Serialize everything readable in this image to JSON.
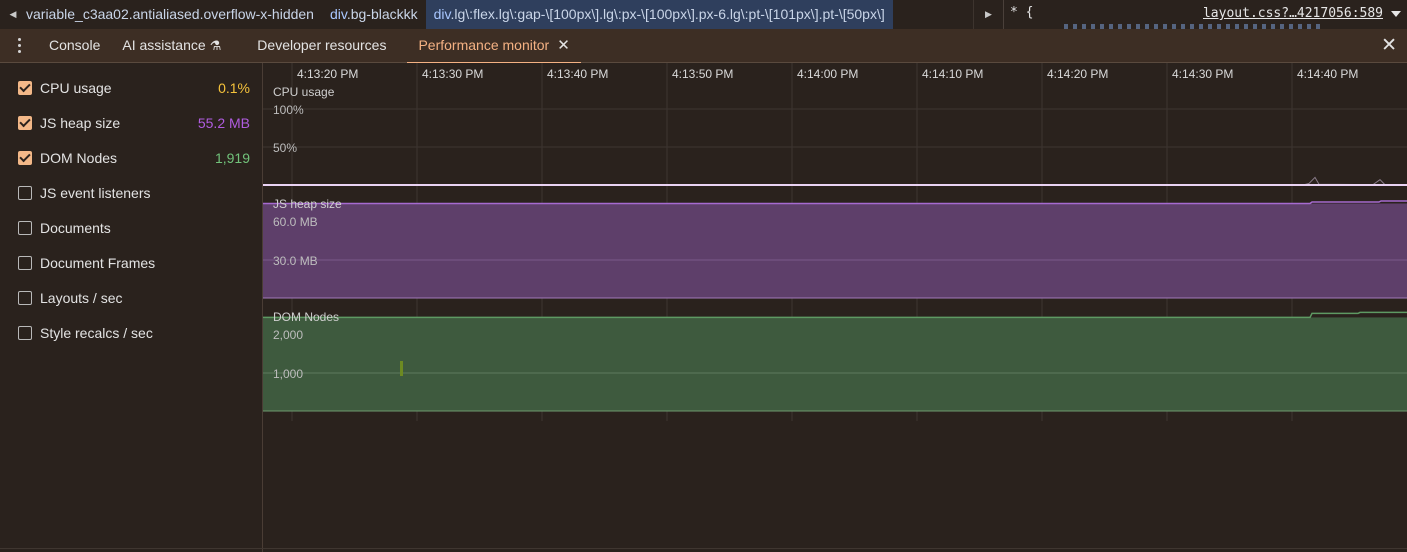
{
  "breadcrumbs": {
    "items": [
      {
        "tag": "",
        "cls": "variable_c3aa02.antialiased.overflow-x-hidden"
      },
      {
        "tag": "div",
        "cls": ".bg-blackkk"
      },
      {
        "tag": "div",
        "cls": ".lg\\:flex.lg\\:gap-\\[100px\\].lg\\:px-\\[100px\\].px-6.lg\\:pt-\\[101px\\].pt-\\[50px\\]"
      }
    ]
  },
  "styles": {
    "selector": "* {",
    "source_link": "layout.css?…4217056:589"
  },
  "tabs": [
    {
      "label": "Console"
    },
    {
      "label": "AI assistance"
    },
    {
      "label": "Developer resources"
    },
    {
      "label": "Performance monitor"
    }
  ],
  "icons": {
    "menu": "kebab-menu-icon",
    "flask": "flask-icon",
    "close": "close-icon"
  },
  "metrics": [
    {
      "label": "CPU usage",
      "checked": true,
      "value": "0.1%",
      "color": "#f6c33b"
    },
    {
      "label": "JS heap size",
      "checked": true,
      "value": "55.2 MB",
      "color": "#b05ce0"
    },
    {
      "label": "DOM Nodes",
      "checked": true,
      "value": "1,919",
      "color": "#71c27a"
    },
    {
      "label": "JS event listeners",
      "checked": false
    },
    {
      "label": "Documents",
      "checked": false
    },
    {
      "label": "Document Frames",
      "checked": false
    },
    {
      "label": "Layouts / sec",
      "checked": false
    },
    {
      "label": "Style recalcs / sec",
      "checked": false
    }
  ],
  "time_labels": [
    "4:13:20 PM",
    "4:13:30 PM",
    "4:13:40 PM",
    "4:13:50 PM",
    "4:14:00 PM",
    "4:14:10 PM",
    "4:14:20 PM",
    "4:14:30 PM",
    "4:14:40 PM"
  ],
  "charts": {
    "cpu": {
      "title": "CPU usage",
      "ticks": [
        "100%",
        "50%"
      ],
      "max": 100,
      "current": 0.1
    },
    "heap": {
      "title": "JS heap size",
      "ticks": [
        "60.0 MB",
        "30.0 MB"
      ],
      "max_mb": 66,
      "level_mb": 55.2
    },
    "dom": {
      "title": "DOM Nodes",
      "ticks": [
        "2,000",
        "1,000"
      ],
      "max": 2200,
      "level": 1919
    }
  },
  "colors": {
    "accent": "#f4b183",
    "cpu": "#f6c33b",
    "heap": "#b05ce0",
    "dom": "#71c27a"
  }
}
